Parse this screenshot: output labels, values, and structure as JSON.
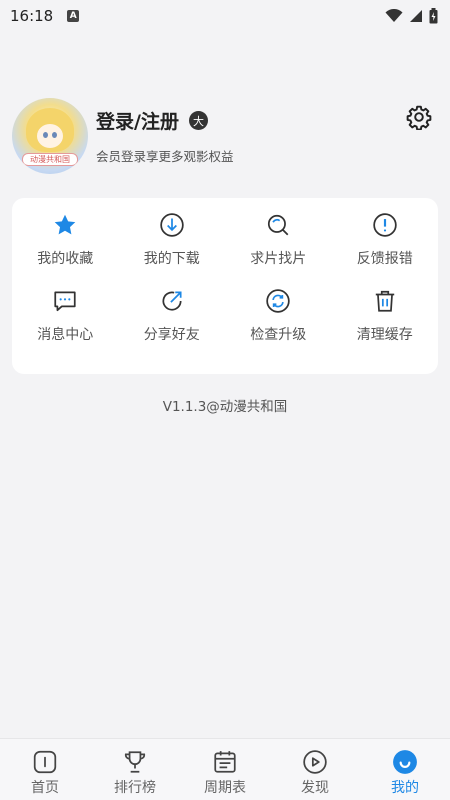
{
  "status": {
    "time": "16:18",
    "a_badge": "A"
  },
  "profile": {
    "avatar_text": "动漫共和国",
    "title": "登录/注册",
    "badge": "大",
    "subtitle": "会员登录享更多观影权益"
  },
  "grid": {
    "items": [
      {
        "label": "我的收藏",
        "icon": "star-icon"
      },
      {
        "label": "我的下载",
        "icon": "download-icon"
      },
      {
        "label": "求片找片",
        "icon": "search-icon"
      },
      {
        "label": "反馈报错",
        "icon": "alert-icon"
      },
      {
        "label": "消息中心",
        "icon": "message-icon"
      },
      {
        "label": "分享好友",
        "icon": "share-icon"
      },
      {
        "label": "检查升级",
        "icon": "refresh-icon"
      },
      {
        "label": "清理缓存",
        "icon": "trash-icon"
      }
    ]
  },
  "version": "V1.1.3@动漫共和国",
  "tabs": [
    {
      "label": "首页",
      "icon": "home-icon"
    },
    {
      "label": "排行榜",
      "icon": "trophy-icon"
    },
    {
      "label": "周期表",
      "icon": "calendar-icon"
    },
    {
      "label": "发现",
      "icon": "play-icon"
    },
    {
      "label": "我的",
      "icon": "profile-icon",
      "active": true
    }
  ],
  "colors": {
    "accent": "#1e88e5",
    "background": "#f3f3f5",
    "card": "#ffffff"
  }
}
